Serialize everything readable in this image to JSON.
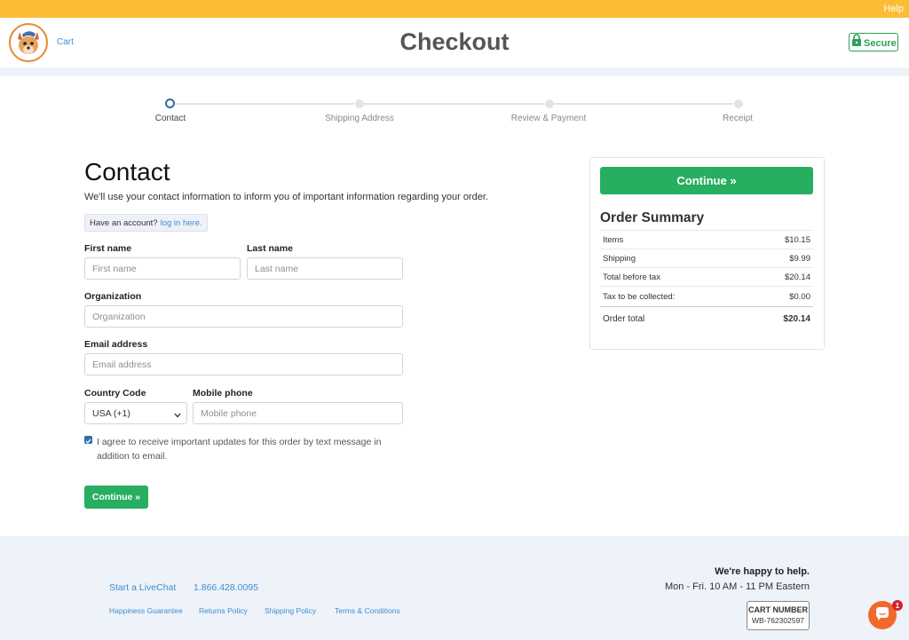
{
  "topbar": {
    "help_label": "Help"
  },
  "header": {
    "cart_label": "Cart",
    "title": "Checkout",
    "secure_label": "Secure"
  },
  "steps": [
    {
      "label": "Contact",
      "active": true
    },
    {
      "label": "Shipping Address",
      "active": false
    },
    {
      "label": "Review & Payment",
      "active": false
    },
    {
      "label": "Receipt",
      "active": false
    }
  ],
  "contact": {
    "title": "Contact",
    "intro": "We'll use your contact information to inform you of important information regarding your order.",
    "account_prompt": "Have an account?",
    "login_link": "log in here.",
    "first_name_label": "First name",
    "first_name_placeholder": "First name",
    "last_name_label": "Last name",
    "last_name_placeholder": "Last name",
    "organization_label": "Organization",
    "organization_placeholder": "Organization",
    "email_label": "Email address",
    "email_placeholder": "Email address",
    "country_code_label": "Country Code",
    "country_code_value": "USA (+1)",
    "mobile_label": "Mobile phone",
    "mobile_placeholder": "Mobile phone",
    "agree_text": "I agree to receive important updates for this order by text message in addition to email.",
    "agree_checked": true,
    "continue_label": "Continue »"
  },
  "summary": {
    "continue_label": "Continue »",
    "title": "Order Summary",
    "rows": [
      {
        "label": "Items",
        "value": "$10.15"
      },
      {
        "label": "Shipping",
        "value": "$9.99"
      },
      {
        "label": "Total before tax",
        "value": "$20.14"
      },
      {
        "label": "Tax to be collected:",
        "value": "$0.00"
      }
    ],
    "total_label": "Order total",
    "total_value": "$20.14"
  },
  "footer": {
    "livechat_label": "Start a LiveChat",
    "phone": "1.866.428.0095",
    "links": [
      "Happiness Guarantee",
      "Returns Policy",
      "Shipping Policy",
      "Terms & Conditions"
    ],
    "happy_text": "We're happy to help.",
    "hours_text": "Mon - Fri. 10 AM - 11 PM Eastern",
    "cart_number_title": "CART NUMBER",
    "cart_number_value": "WB-762302597"
  },
  "chat": {
    "badge_count": "1"
  },
  "colors": {
    "accent_yellow": "#fbbd34",
    "brand_green": "#27ae60",
    "link_blue": "#3d8fd1",
    "chat_orange": "#f1682c"
  }
}
